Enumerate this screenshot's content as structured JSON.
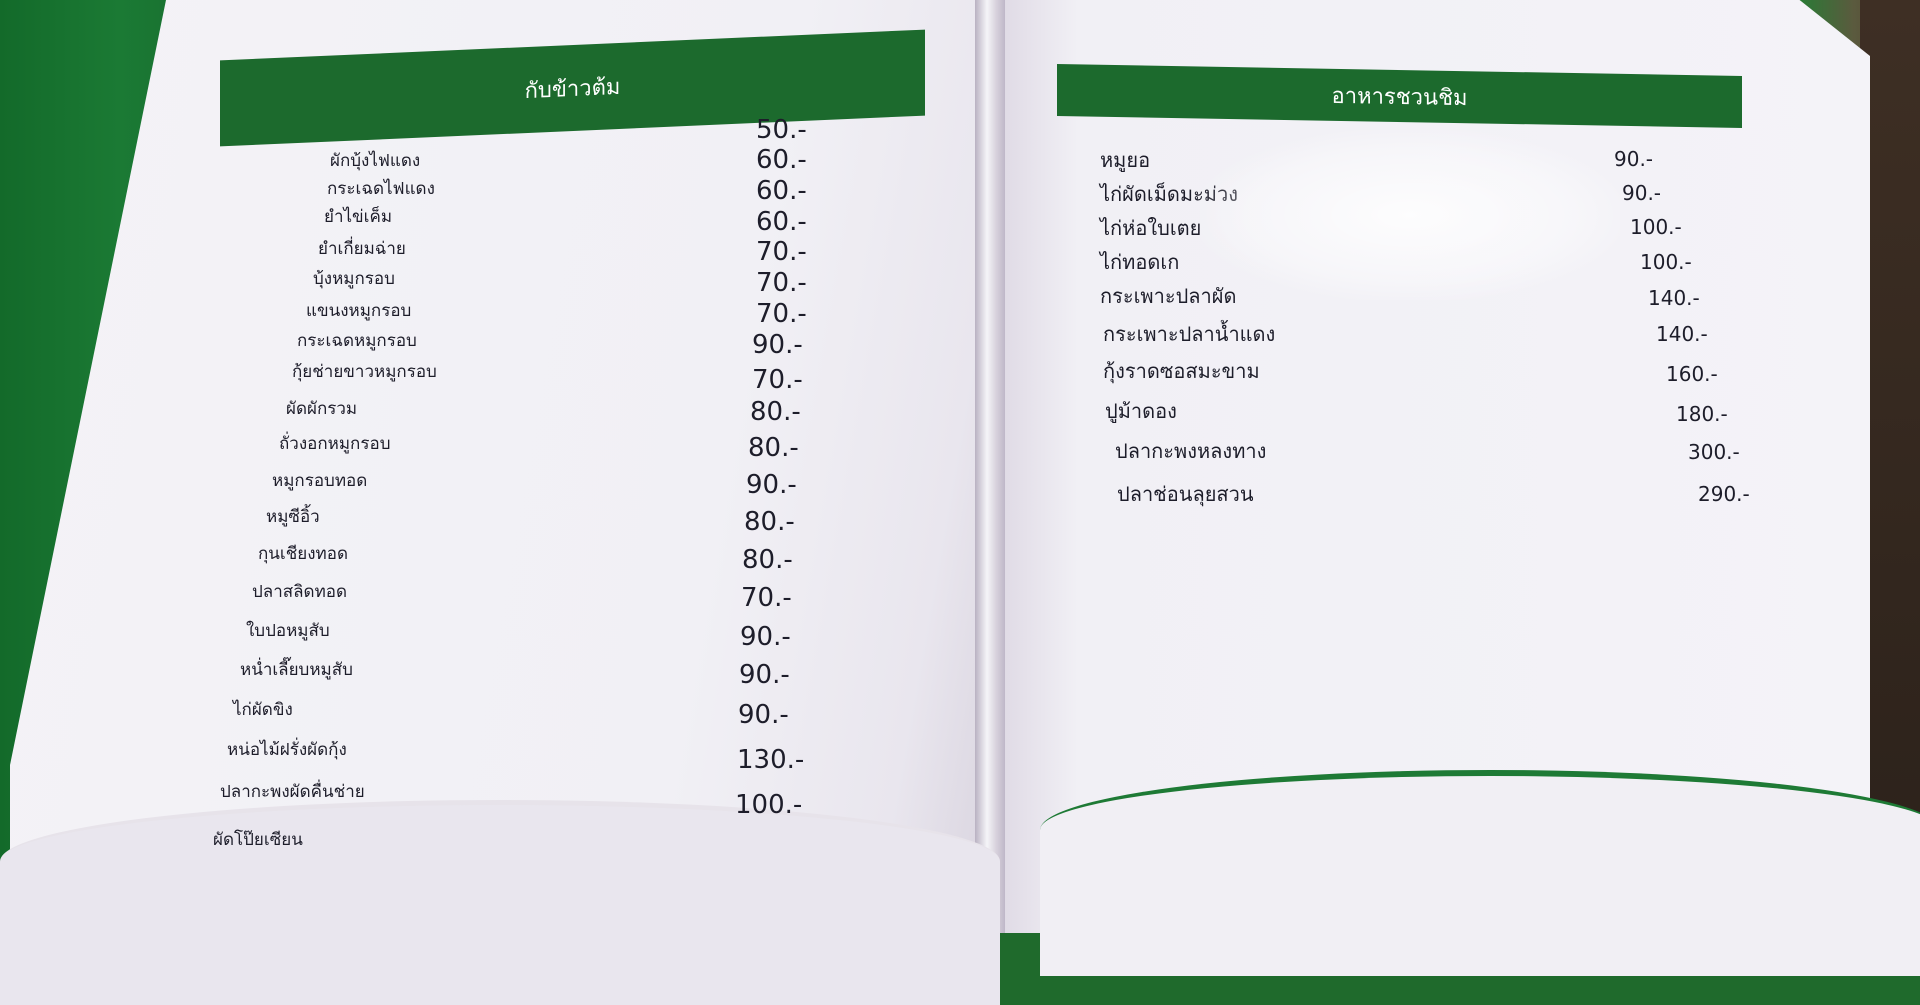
{
  "menu": {
    "left": {
      "header": "กับข้าวต้ม",
      "items": [
        {
          "name": "",
          "price": "50.-"
        },
        {
          "name": "ผักบุ้งไฟแดง",
          "price": "60.-"
        },
        {
          "name": "กระเฉดไฟแดง",
          "price": "60.-"
        },
        {
          "name": "ยำไข่เค็ม",
          "price": "60.-"
        },
        {
          "name": "ยำเกี่ยมฉ่าย",
          "price": "70.-"
        },
        {
          "name": "บุ้งหมูกรอบ",
          "price": "70.-"
        },
        {
          "name": "แขนงหมูกรอบ",
          "price": "70.-"
        },
        {
          "name": "กระเฉดหมูกรอบ",
          "price": "90.-"
        },
        {
          "name": "กุ้ยช่ายขาวหมูกรอบ",
          "price": "70.-"
        },
        {
          "name": "ผัดผักรวม",
          "price": "80.-"
        },
        {
          "name": "ถั่วงอกหมูกรอบ",
          "price": "80.-"
        },
        {
          "name": "หมูกรอบทอด",
          "price": "90.-"
        },
        {
          "name": "หมูซีอิ้ว",
          "price": "80.-"
        },
        {
          "name": "กุนเชียงทอด",
          "price": "80.-"
        },
        {
          "name": "ปลาสลิดทอด",
          "price": "70.-"
        },
        {
          "name": "ใบปอหมูสับ",
          "price": "90.-"
        },
        {
          "name": "หน่ำเลี๊ยบหมูสับ",
          "price": "90.-"
        },
        {
          "name": "ไก่ผัดขิง",
          "price": "90.-"
        },
        {
          "name": "หน่อไม้ฝรั่งผัดกุ้ง",
          "price": "130.-"
        },
        {
          "name": "ปลากะพงผัดคื่นช่าย",
          "price": "100.-"
        },
        {
          "name": "ผัดโป๊ยเซียน",
          "price": ""
        }
      ]
    },
    "right": {
      "header": "อาหารชวนชิม",
      "items": [
        {
          "name": "หมูยอ",
          "price": "90.-"
        },
        {
          "name": "ไก่ผัดเม็ดมะม่วง",
          "price": "90.-"
        },
        {
          "name": "ไก่ห่อใบเตย",
          "price": "100.-"
        },
        {
          "name": "ไก่ทอดเก",
          "price": "100.-"
        },
        {
          "name": "กระเพาะปลาผัด",
          "price": "140.-"
        },
        {
          "name": "กระเพาะปลาน้ำแดง",
          "price": "140.-"
        },
        {
          "name": "กุ้งราดซอสมะขาม",
          "price": "160.-"
        },
        {
          "name": "ปูม้าดอง",
          "price": "180.-"
        },
        {
          "name": "ปลากะพงหลงทาง",
          "price": "300.-"
        },
        {
          "name": "ปลาช่อนลุยสวน",
          "price": "290.-"
        }
      ]
    }
  }
}
